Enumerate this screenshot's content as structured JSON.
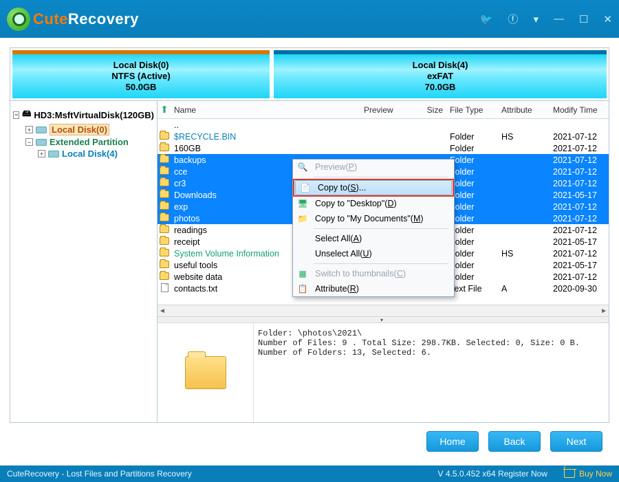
{
  "app": {
    "name_prefix": "Cute",
    "name_suffix": "Recovery"
  },
  "disks": [
    {
      "title": "Local Disk(0)",
      "fs": "NTFS (Active)",
      "size": "50.0GB"
    },
    {
      "title": "Local Disk(4)",
      "fs": "exFAT",
      "size": "70.0GB"
    }
  ],
  "tree": {
    "root": "HD3:MsftVirtualDisk(120GB)",
    "local0": "Local Disk(0)",
    "ext": "Extended Partition",
    "local4": "Local Disk(4)"
  },
  "columns": {
    "name": "Name",
    "preview": "Preview",
    "size": "Size",
    "type": "File Type",
    "attr": "Attribute",
    "mod": "Modify Time"
  },
  "rows": [
    {
      "name": "..",
      "type": "",
      "attr": "",
      "mod": "",
      "icon": "up",
      "sel": false
    },
    {
      "name": "$RECYCLE.BIN",
      "type": "Folder",
      "attr": "HS",
      "mod": "2021-07-12",
      "icon": "folder",
      "sel": false,
      "cls": "link"
    },
    {
      "name": "160GB",
      "type": "Folder",
      "attr": "",
      "mod": "2021-07-12",
      "icon": "folder",
      "sel": false
    },
    {
      "name": "backups",
      "type": "Folder",
      "attr": "",
      "mod": "2021-07-12",
      "icon": "folder",
      "sel": true
    },
    {
      "name": "cce",
      "type": "Folder",
      "attr": "",
      "mod": "2021-07-12",
      "icon": "folder",
      "sel": true
    },
    {
      "name": "cr3",
      "type": "Folder",
      "attr": "",
      "mod": "2021-07-12",
      "icon": "folder",
      "sel": true
    },
    {
      "name": "Downloads",
      "type": "Folder",
      "attr": "",
      "mod": "2021-05-17",
      "icon": "folder",
      "sel": true
    },
    {
      "name": "exp",
      "type": "Folder",
      "attr": "",
      "mod": "2021-07-12",
      "icon": "folder",
      "sel": true
    },
    {
      "name": "photos",
      "type": "Folder",
      "attr": "",
      "mod": "2021-07-12",
      "icon": "folder",
      "sel": true
    },
    {
      "name": "readings",
      "type": "Folder",
      "attr": "",
      "mod": "2021-07-12",
      "icon": "folder",
      "sel": false
    },
    {
      "name": "receipt",
      "type": "Folder",
      "attr": "",
      "mod": "2021-05-17",
      "icon": "folder",
      "sel": false
    },
    {
      "name": "System Volume Information",
      "type": "Folder",
      "attr": "HS",
      "mod": "2021-07-12",
      "icon": "folder",
      "sel": false,
      "cls": "sys"
    },
    {
      "name": "useful tools",
      "type": "Folder",
      "attr": "",
      "mod": "2021-05-17",
      "icon": "folder",
      "sel": false
    },
    {
      "name": "website data",
      "type": "Folder",
      "attr": "",
      "mod": "2021-07-12",
      "icon": "folder",
      "sel": false
    },
    {
      "name": "contacts.txt",
      "type": "Text File",
      "attr": "A",
      "mod": "2020-09-30",
      "icon": "text",
      "sel": false
    }
  ],
  "context": {
    "preview": "Preview(P)",
    "copyto": "Copy to(S)...",
    "copydesk": "Copy to \"Desktop\"(D)",
    "copydocs": "Copy to \"My Documents\"(M)",
    "selectall": "Select All(A)",
    "unselectall": "Unselect All(U)",
    "thumbs": "Switch to thumbnails(C)",
    "attribute": "Attribute(R)"
  },
  "preview_text": "Folder: \\photos\\2021\\\nNumber of Files: 9 . Total Size: 298.7KB. Selected: 0, Size: 0 B.\nNumber of Folders: 13, Selected: 6.",
  "buttons": {
    "home": "Home",
    "back": "Back",
    "next": "Next"
  },
  "status": {
    "left": "CuteRecovery - Lost Files and Partitions Recovery",
    "version": "V 4.5.0.452 x64  Register Now",
    "buy": "Buy Now"
  }
}
